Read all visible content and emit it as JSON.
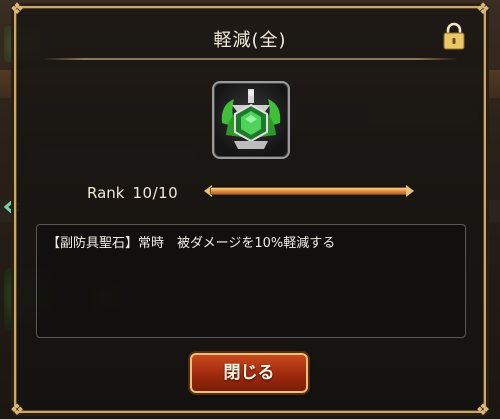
{
  "dialog": {
    "title": "軽減(全)",
    "lock_icon": "padlock-icon",
    "emblem_icon": "green-gem-crest-icon"
  },
  "rank": {
    "label": "Rank",
    "value": "10/10",
    "progress": 1.0
  },
  "description": {
    "text": "【副防具聖石】常時　被ダメージを10%軽減する"
  },
  "buttons": {
    "close_label": "閉じる"
  },
  "colors": {
    "accent_gold": "#c9a86a",
    "button_red": "#b8361a",
    "bar_orange": "#e08c40",
    "gem_green": "#3fbf3a"
  }
}
